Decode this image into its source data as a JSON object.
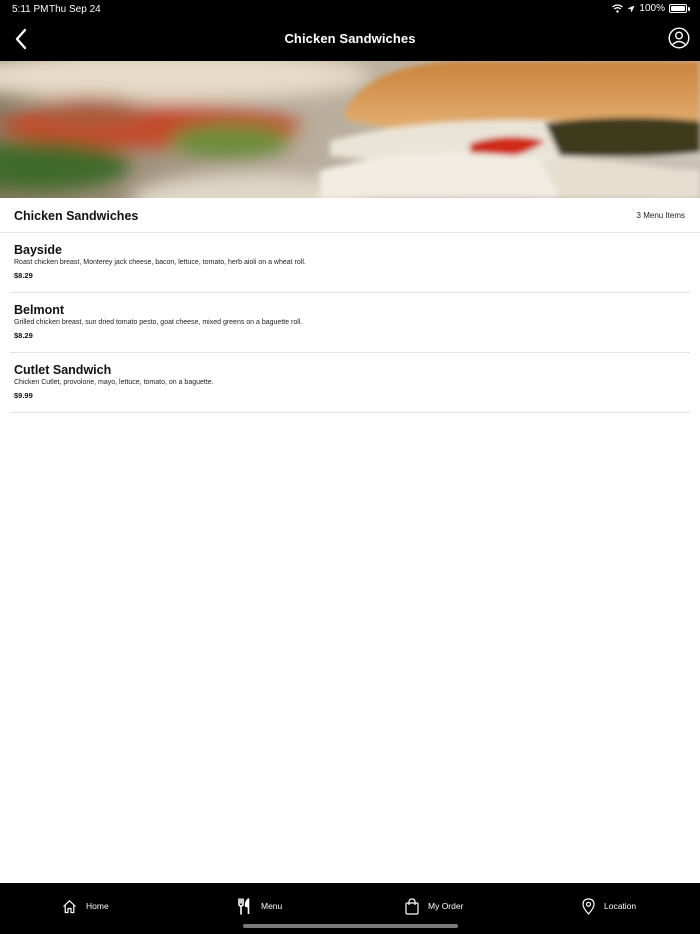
{
  "status_bar": {
    "time": "5:11 PM",
    "date": "Thu Sep 24",
    "battery": "100%"
  },
  "nav": {
    "title": "Chicken Sandwiches",
    "back_icon": "chevron-left-icon",
    "account_icon": "user-circle-icon"
  },
  "section": {
    "title": "Chicken Sandwiches",
    "count": "3 Menu Items"
  },
  "menu_items": [
    {
      "name": "Bayside",
      "description": "Roast chicken breast, Monterey jack cheese, bacon, lettuce, tomato, herb aioli on a wheat roll.",
      "price": "$8.29"
    },
    {
      "name": "Belmont",
      "description": "Grilled chicken breast, sun dried tomato pesto, goat cheese, mixed greens on a baguette roll.",
      "price": "$8.29"
    },
    {
      "name": "Cutlet Sandwich",
      "description": "Chicken Cutlet, provolone, mayo, lettuce, tomato, on a baguette.",
      "price": "$9.99"
    }
  ],
  "tabs": [
    {
      "label": "Home",
      "icon": "home-icon"
    },
    {
      "label": "Menu",
      "icon": "utensils-icon"
    },
    {
      "label": "My Order",
      "icon": "shopping-bag-icon"
    },
    {
      "label": "Location",
      "icon": "location-pin-icon"
    }
  ],
  "colors": {
    "bar_background": "#000000",
    "bar_text": "#ffffff",
    "divider": "#e3e3e3"
  }
}
